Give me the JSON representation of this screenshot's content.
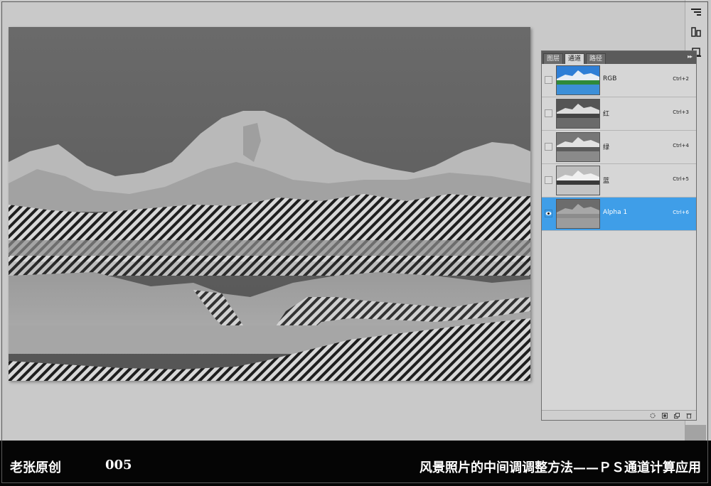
{
  "panel": {
    "tabs": [
      "图层",
      "通道",
      "路径"
    ],
    "active_tab": "通道",
    "menu_icon": "double-chevron-icon",
    "channels": [
      {
        "name": "RGB",
        "shortcut": "Ctrl+2",
        "thumb": "color"
      },
      {
        "name": "红",
        "shortcut": "Ctrl+3",
        "thumb": "gray"
      },
      {
        "name": "绿",
        "shortcut": "Ctrl+4",
        "thumb": "gray"
      },
      {
        "name": "蓝",
        "shortcut": "Ctrl+5",
        "thumb": "gray"
      },
      {
        "name": "Alpha 1",
        "shortcut": "Ctrl+6",
        "thumb": "alpha",
        "selected": true,
        "visible": true
      }
    ],
    "footer_icons": [
      "load-selection-icon",
      "save-selection-icon",
      "new-channel-icon",
      "delete-channel-icon"
    ]
  },
  "tools": [
    "tool-a-icon",
    "tool-b-icon",
    "tool-c-icon"
  ],
  "colors": {
    "selection": "#3f9ee8",
    "panel_bg": "#d6d6d6",
    "workspace": "#c9c9c9",
    "caption_bg": "#050505"
  },
  "caption": {
    "left": "老张原创",
    "number": "005",
    "right": "风景照片的中间调调整方法——ＰＳ通道计算应用"
  }
}
